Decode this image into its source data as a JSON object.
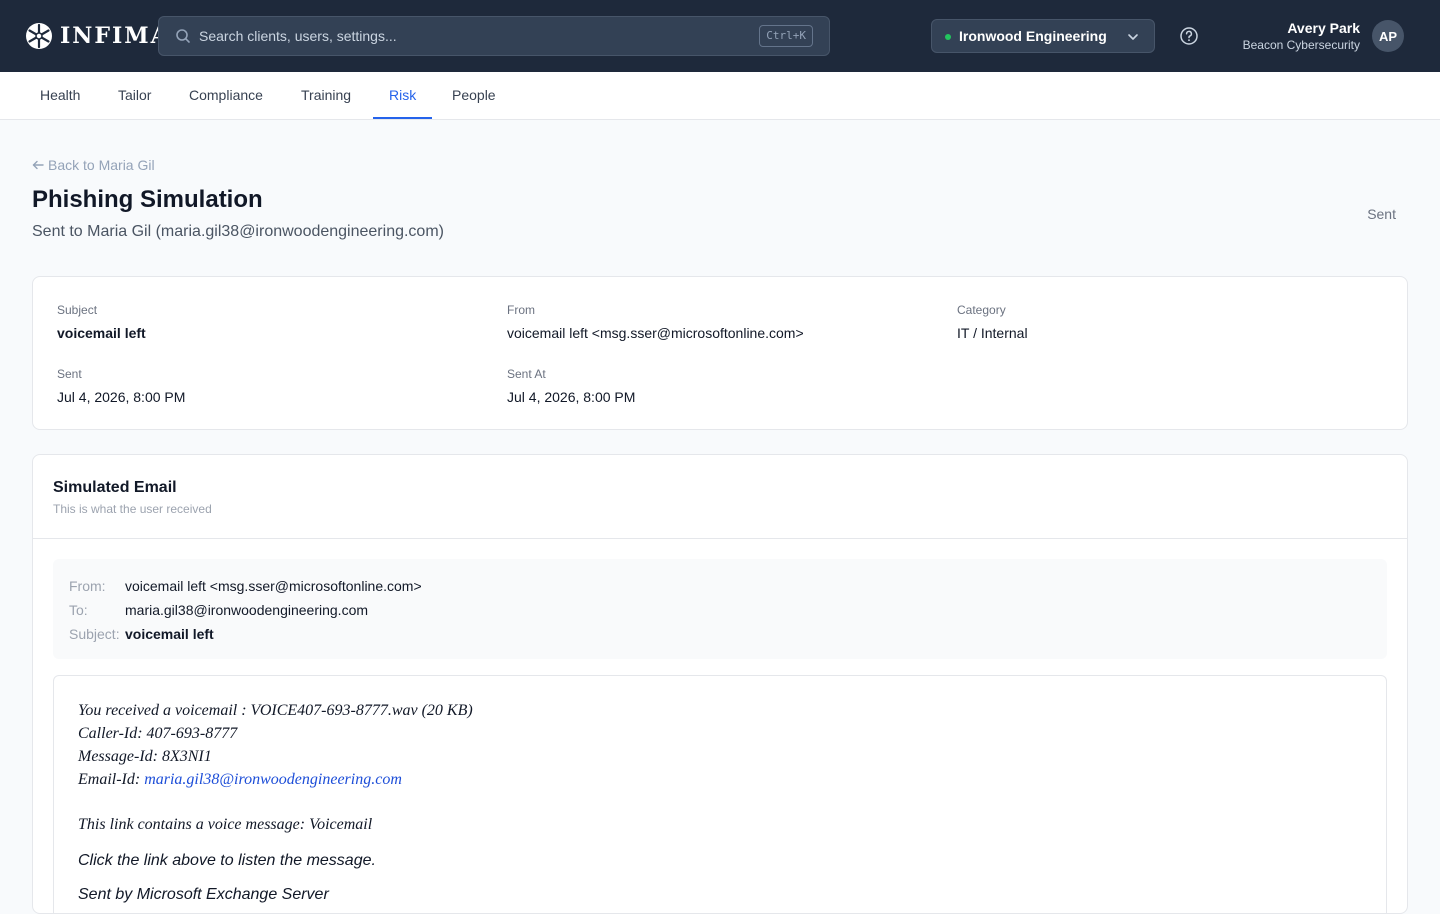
{
  "app": {
    "logo_text": "INFIMA"
  },
  "search": {
    "placeholder": "Search clients, users, settings...",
    "shortcut": "Ctrl+K"
  },
  "org_selector": {
    "selected": "Ironwood Engineering"
  },
  "user": {
    "name": "Avery Park",
    "org": "Beacon Cybersecurity",
    "initials": "AP"
  },
  "tabs": [
    {
      "label": "Health"
    },
    {
      "label": "Tailor"
    },
    {
      "label": "Compliance"
    },
    {
      "label": "Training"
    },
    {
      "label": "Risk"
    },
    {
      "label": "People"
    }
  ],
  "active_tab": "Risk",
  "page": {
    "back_label": "Back to Maria Gil",
    "title": "Phishing Simulation",
    "subtitle": "Sent to Maria Gil (maria.gil38@ironwoodengineering.com)",
    "status": "Sent"
  },
  "details": {
    "subject_label": "Subject",
    "subject": "voicemail left",
    "from_label": "From",
    "from": "voicemail left <msg.sser@microsoftonline.com>",
    "category_label": "Category",
    "category": "IT / Internal",
    "sent_label": "Sent",
    "sent": "Jul 4, 2026, 8:00 PM",
    "sent_at_label": "Sent At",
    "sent_at": "Jul 4, 2026, 8:00 PM"
  },
  "email": {
    "title": "Simulated Email",
    "description": "This is what the user received",
    "from_label": "From:",
    "from": "voicemail left <msg.sser@microsoftonline.com>",
    "to_label": "To:",
    "to": "maria.gil38@ironwoodengineering.com",
    "subject_label": "Subject:",
    "subject": "voicemail left",
    "body": {
      "line1": "You received a voicemail : VOICE407-693-8777.wav (20 KB)",
      "line2": "Caller-Id: 407-693-8777",
      "line3": "Message-Id: 8X3NI1",
      "line4_label": "Email-Id: ",
      "line4_link": "maria.gil38@ironwoodengineering.com",
      "line5": "This link contains a voice message: Voicemail",
      "line6": "Click the link above to listen the message.",
      "line7": "Sent by Microsoft Exchange Server"
    }
  },
  "colors": {
    "topbar": "#1e293b",
    "accent": "#2563eb",
    "online_dot": "#22c55e"
  }
}
